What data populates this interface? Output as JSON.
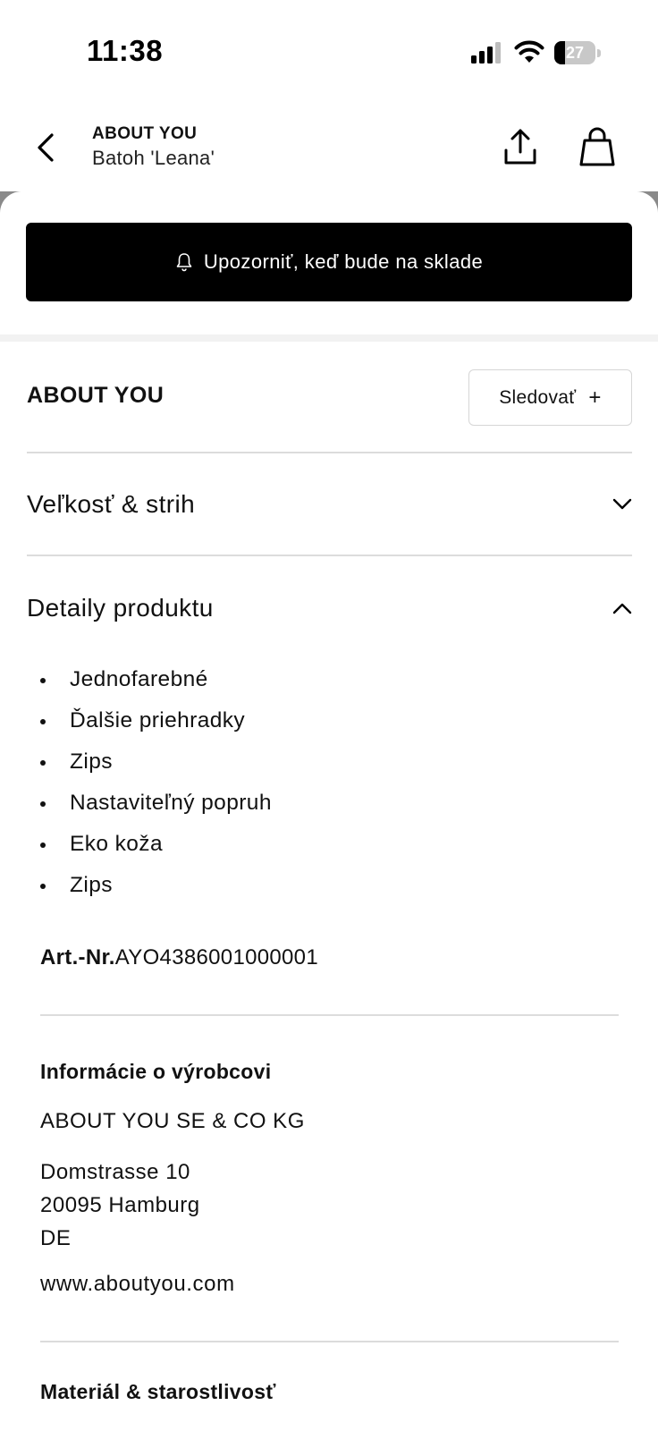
{
  "status_bar": {
    "time": "11:38",
    "battery_percent": 27,
    "battery_label": "27",
    "icons": [
      "signal-icon",
      "wifi-icon",
      "battery-icon"
    ]
  },
  "header": {
    "brand": "ABOUT YOU",
    "product": "Batoh 'Leana'",
    "icons": [
      "chevron-left-icon",
      "share-icon",
      "shopping-bag-icon"
    ]
  },
  "notify": {
    "label": "Upozorniť, keď bude na sklade",
    "icon": "bell-icon"
  },
  "brand_row": {
    "name": "ABOUT YOU",
    "follow_label": "Sledovať",
    "follow_icon": "+"
  },
  "accordions": {
    "size": {
      "label": "Veľkosť & strih",
      "expanded": false
    },
    "details": {
      "label": "Detaily produktu",
      "expanded": true
    }
  },
  "details": {
    "items": [
      "Jednofarebné",
      "Ďalšie priehradky",
      "Zips",
      "Nastaviteľný popruh",
      "Eko koža",
      "Zips"
    ],
    "art_label": "Art.-Nr.",
    "art_value": "AYO4386001000001"
  },
  "manufacturer": {
    "title": "Informácie o výrobcovi",
    "name": "ABOUT YOU SE & CO KG",
    "address_line1": "Domstrasse 10",
    "address_line2": "20095 Hamburg",
    "address_line3": "DE",
    "website": "www.aboutyou.com"
  },
  "material": {
    "title": "Materiál & starostlivosť"
  },
  "colors": {
    "primary": "#000000",
    "background": "#ffffff",
    "divider": "#dcdcdc"
  }
}
